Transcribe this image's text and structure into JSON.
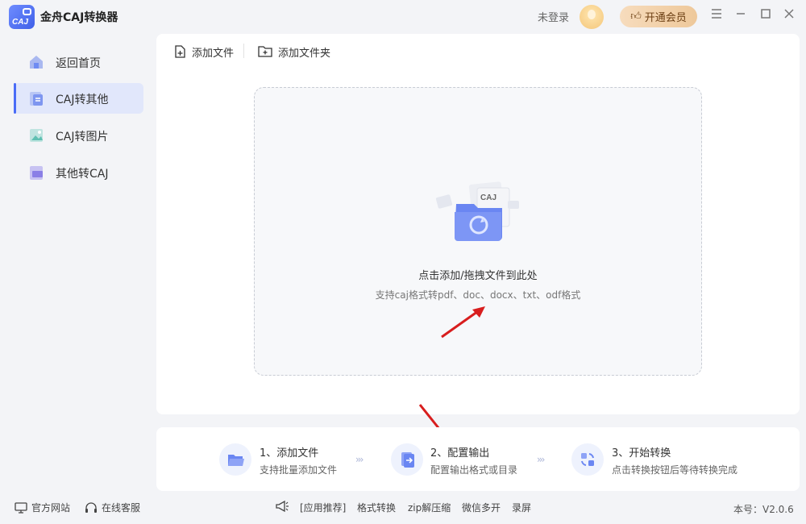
{
  "app": {
    "title": "金舟CAJ转换器",
    "logo_text": "CAJ"
  },
  "header": {
    "login_text": "未登录",
    "vip_label": "开通会员"
  },
  "sidebar": {
    "items": [
      {
        "label": "返回首页",
        "icon": "home-icon"
      },
      {
        "label": "CAJ转其他",
        "icon": "caj-convert-icon",
        "active": true
      },
      {
        "label": "CAJ转图片",
        "icon": "image-icon"
      },
      {
        "label": "其他转CAJ",
        "icon": "to-caj-icon"
      }
    ]
  },
  "toolbar": {
    "add_file": "添加文件",
    "add_folder": "添加文件夹"
  },
  "dropzone": {
    "illustration_text": "CAJ",
    "main_text": "点击添加/拖拽文件到此处",
    "sub_text": "支持caj格式转pdf、doc、docx、txt、odf格式"
  },
  "steps": [
    {
      "title": "1、添加文件",
      "desc": "支持批量添加文件"
    },
    {
      "title": "2、配置输出",
      "desc": "配置输出格式或目录"
    },
    {
      "title": "3、开始转换",
      "desc": "点击转换按钮后等待转换完成"
    }
  ],
  "footer": {
    "website": "官方网站",
    "support": "在线客服",
    "promo": "[应用推荐]",
    "links": [
      "格式转换",
      "zip解压缩",
      "微信多开",
      "录屏"
    ],
    "version": "本号：V2.0.6"
  },
  "colors": {
    "accent": "#4a6cf7",
    "active_bg": "#e1e7fb",
    "vip_gold": "#eec89a"
  }
}
